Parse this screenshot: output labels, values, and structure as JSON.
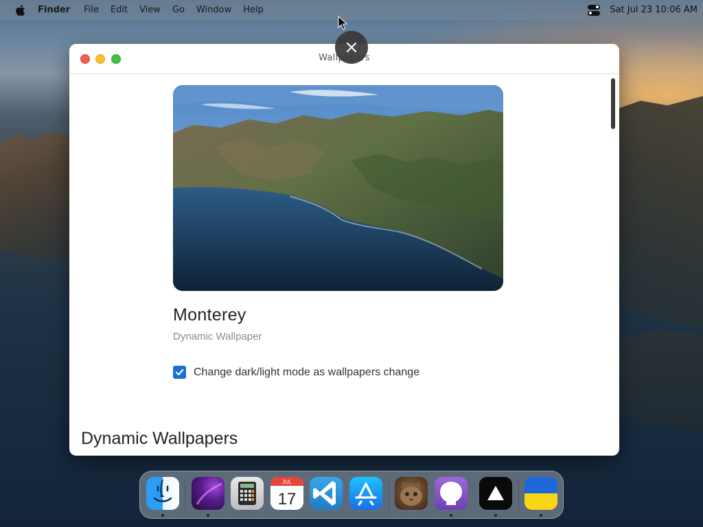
{
  "menubar": {
    "app_name": "Finder",
    "items": [
      "File",
      "Edit",
      "View",
      "Go",
      "Window",
      "Help"
    ],
    "clock": "Sat Jul 23  10:06 AM",
    "icons": [
      "apple-logo-icon",
      "control-center-icon"
    ]
  },
  "window": {
    "title": "Wallpapers",
    "wallpaper": {
      "name": "Monterey",
      "subtitle": "Dynamic Wallpaper"
    },
    "checkbox": {
      "label": "Change dark/light mode as wallpapers change",
      "checked": true
    },
    "section_title": "Dynamic Wallpapers"
  },
  "dock": {
    "apps": [
      {
        "name": "Finder",
        "icon": "finder-icon",
        "running": true
      },
      {
        "name": "Arc",
        "icon": "arc-browser-icon",
        "running": true
      },
      {
        "name": "Calculator",
        "icon": "calculator-icon",
        "running": false
      },
      {
        "name": "Calendar",
        "icon": "calendar-icon",
        "running": false,
        "month": "JUL",
        "day": "17"
      },
      {
        "name": "Visual Studio Code",
        "icon": "vscode-icon",
        "running": false
      },
      {
        "name": "App Store",
        "icon": "app-store-icon",
        "running": false
      },
      {
        "name": "Cat Photo",
        "icon": "cat-app-icon",
        "running": false
      },
      {
        "name": "GitHub Desktop",
        "icon": "github-icon",
        "running": true
      },
      {
        "name": "Vercel",
        "icon": "vercel-icon",
        "running": true
      },
      {
        "name": "Ukraine",
        "icon": "ukraine-flag-icon",
        "running": true
      }
    ]
  },
  "colors": {
    "accent": "#1a6fd8",
    "traffic_close": "#ee5e57",
    "traffic_minimize": "#f6be30",
    "traffic_maximize": "#3dc146"
  }
}
